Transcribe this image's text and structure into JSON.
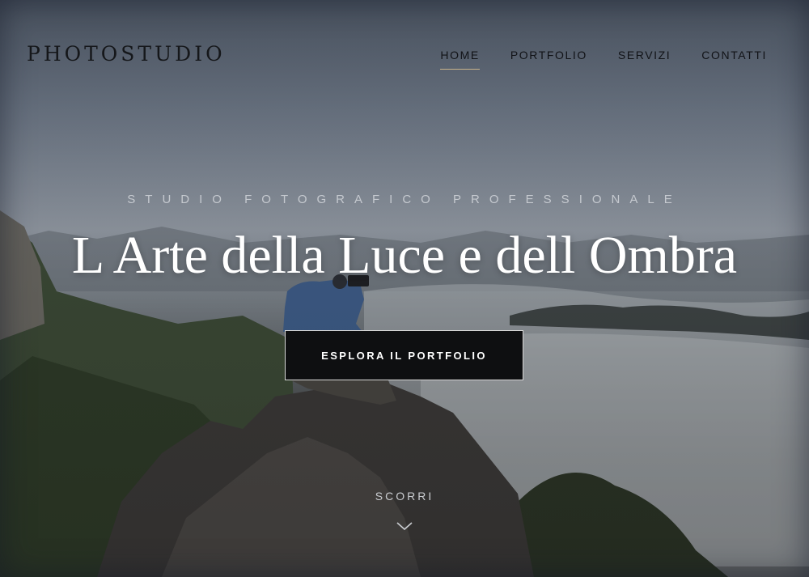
{
  "header": {
    "logo": "PHOTOSTUDIO",
    "nav": [
      {
        "label": "HOME",
        "active": true
      },
      {
        "label": "PORTFOLIO",
        "active": false
      },
      {
        "label": "SERVIZI",
        "active": false
      },
      {
        "label": "CONTATTI",
        "active": false
      }
    ]
  },
  "hero": {
    "subtitle": "STUDIO FOTOGRAFICO PROFESSIONALE",
    "title": "L Arte della Luce e dell Ombra",
    "cta_label": "ESPLORA IL PORTFOLIO",
    "scroll_label": "SCORRI",
    "scroll_icon": "chevron-down-icon",
    "background": "photographer-on-mountain-rock-above-clouds"
  },
  "colors": {
    "accent": "#c9b38a",
    "button_bg": "#0e0f11",
    "title_text": "#ffffff"
  }
}
